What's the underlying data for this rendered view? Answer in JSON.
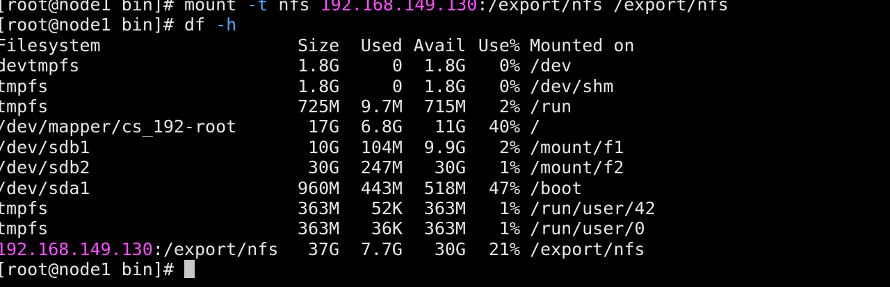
{
  "prompt": "[root@node1 bin]# ",
  "commands": {
    "mount": {
      "prefix": "mount ",
      "flag": "-t",
      "middle": " nfs ",
      "ip": "192.168.149.130",
      "rest": ":/export/nfs /export/nfs"
    },
    "df": {
      "prefix": "df ",
      "flag": "-h"
    }
  },
  "df_table": {
    "headers": [
      "Filesystem",
      "Size",
      "Used",
      "Avail",
      "Use%",
      "Mounted on"
    ],
    "rows": [
      {
        "fs": "devtmpfs",
        "size": "1.8G",
        "used": "0",
        "avail": "1.8G",
        "use": "0%",
        "mount": "/dev"
      },
      {
        "fs": "tmpfs",
        "size": "1.8G",
        "used": "0",
        "avail": "1.8G",
        "use": "0%",
        "mount": "/dev/shm"
      },
      {
        "fs": "tmpfs",
        "size": "725M",
        "used": "9.7M",
        "avail": "715M",
        "use": "2%",
        "mount": "/run"
      },
      {
        "fs": "/dev/mapper/cs_192-root",
        "size": "17G",
        "used": "6.8G",
        "avail": "11G",
        "use": "40%",
        "mount": "/"
      },
      {
        "fs": "/dev/sdb1",
        "size": "10G",
        "used": "104M",
        "avail": "9.9G",
        "use": "2%",
        "mount": "/mount/f1"
      },
      {
        "fs": "/dev/sdb2",
        "size": "30G",
        "used": "247M",
        "avail": "30G",
        "use": "1%",
        "mount": "/mount/f2"
      },
      {
        "fs": "/dev/sda1",
        "size": "960M",
        "used": "443M",
        "avail": "518M",
        "use": "47%",
        "mount": "/boot"
      },
      {
        "fs": "tmpfs",
        "size": "363M",
        "used": "52K",
        "avail": "363M",
        "use": "1%",
        "mount": "/run/user/42"
      },
      {
        "fs": "tmpfs",
        "size": "363M",
        "used": "36K",
        "avail": "363M",
        "use": "1%",
        "mount": "/run/user/0"
      }
    ],
    "nfs_row": {
      "ip": "192.168.149.130",
      "path": ":/export/nfs",
      "size": "37G",
      "used": "7.7G",
      "avail": "30G",
      "use": "21%",
      "mount": "/export/nfs"
    }
  },
  "colors": {
    "background": "#000000",
    "text": "#e6e6e6",
    "ip_highlight": "#ff4dff",
    "option_flag": "#4da6ff",
    "cursor": "#c8c8c8"
  }
}
